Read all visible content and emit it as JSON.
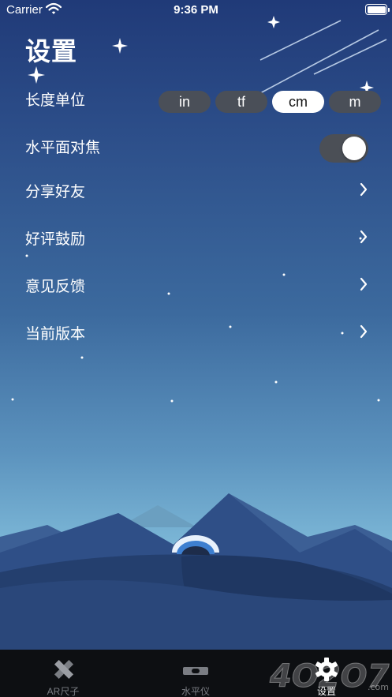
{
  "status_bar": {
    "carrier": "Carrier",
    "time": "9:36 PM"
  },
  "page": {
    "title": "设置"
  },
  "settings": {
    "length_unit": {
      "label": "长度单位",
      "options": [
        "in",
        "tf",
        "cm",
        "m"
      ],
      "selected": "cm"
    },
    "horizontal_focus": {
      "label": "水平面对焦",
      "enabled": true
    },
    "items": [
      {
        "label": "分享好友"
      },
      {
        "label": "好评鼓励"
      },
      {
        "label": "意见反馈"
      },
      {
        "label": "当前版本"
      }
    ]
  },
  "tab_bar": {
    "tabs": [
      {
        "label": "AR尺子",
        "icon": "ruler-pencil-icon",
        "active": false
      },
      {
        "label": "水平仪",
        "icon": "level-icon",
        "active": false
      },
      {
        "label": "设置",
        "icon": "gear-icon",
        "active": true
      }
    ]
  },
  "watermark": {
    "text": "4O2O7",
    "suffix": ".com"
  },
  "colors": {
    "selected_segment": "#ffffff",
    "unselected_segment": "#4a4f58",
    "toggle_track": "#4b4f56",
    "tab_bar_background": "#0d0f12",
    "tab_inactive": "#7a7d83",
    "tab_active": "#ffffff"
  }
}
